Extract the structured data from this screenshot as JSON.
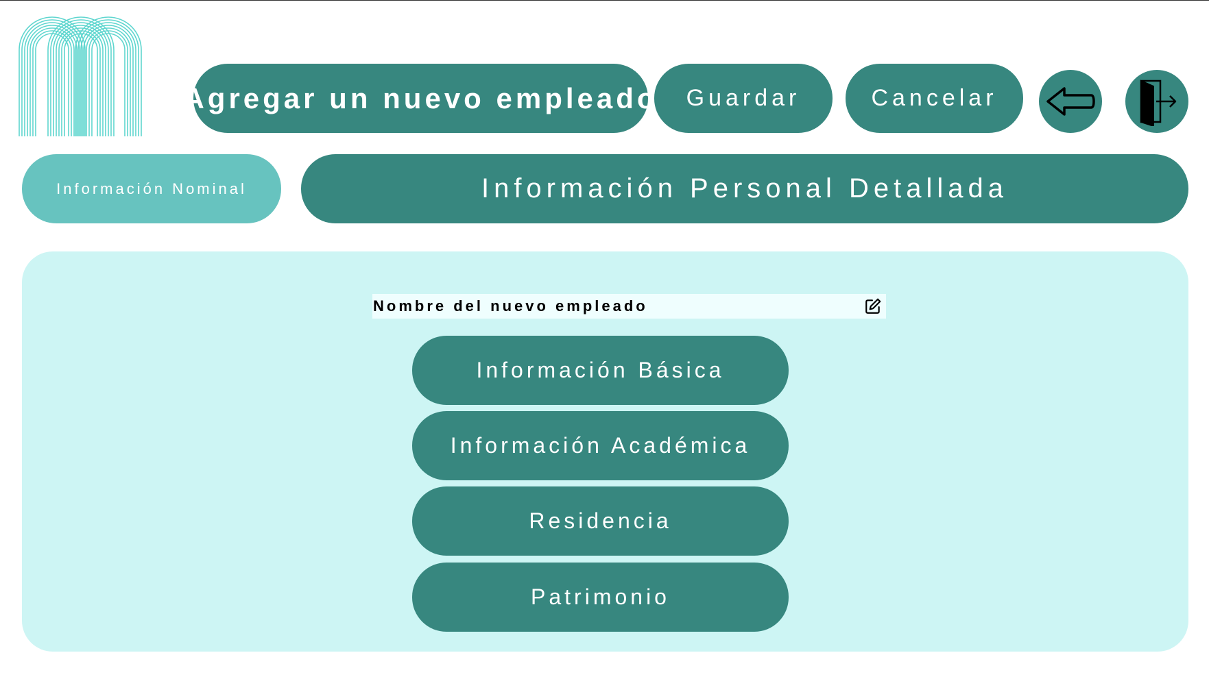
{
  "header": {
    "title": "Agregar un nuevo empleado",
    "save_label": "Guardar",
    "cancel_label": "Cancelar",
    "back_icon": "arrow-left-icon",
    "exit_icon": "exit-door-icon"
  },
  "tabs": [
    {
      "label": "Información Nominal",
      "active": false
    },
    {
      "label": "Información Personal Detallada",
      "active": true
    }
  ],
  "employee_name": {
    "label": "Nombre del nuevo empleado",
    "edit_icon": "edit-icon"
  },
  "menu": [
    {
      "label": "Información Básica"
    },
    {
      "label": "Información Académica"
    },
    {
      "label": "Residencia"
    },
    {
      "label": "Patrimonio"
    }
  ],
  "colors": {
    "primary": "#37877f",
    "secondary": "#67c3bf",
    "panel": "#cdf5f4",
    "field": "#effefe",
    "logo": "#5fd6cf"
  }
}
